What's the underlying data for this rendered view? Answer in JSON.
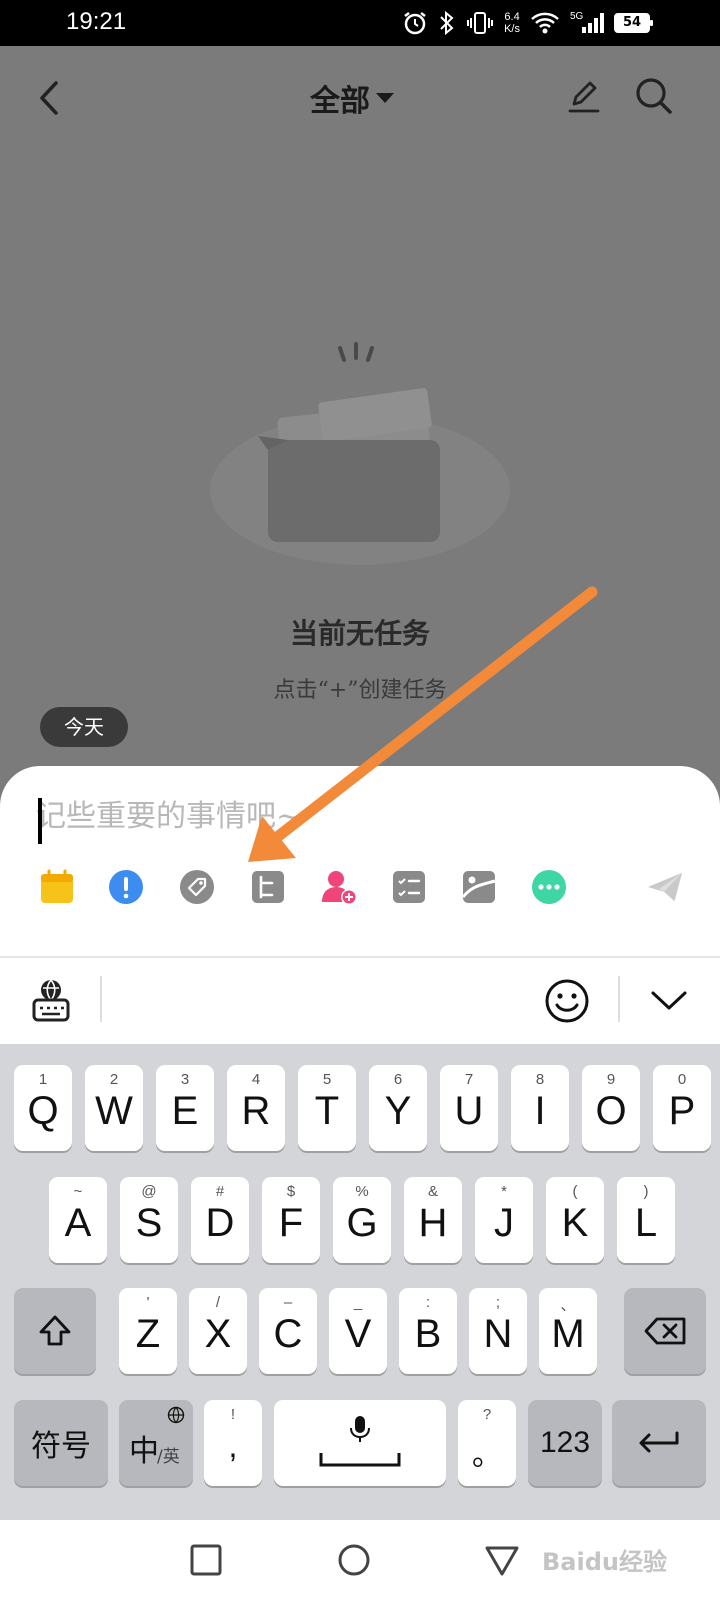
{
  "status_bar": {
    "time": "19:21",
    "net_speed_value": "6.4",
    "net_speed_unit": "K/s",
    "signal_label": "5G",
    "battery": "54"
  },
  "header": {
    "title": "全部",
    "back_icon": "chevron-left-icon",
    "edit_icon": "pencil-icon",
    "search_icon": "search-icon"
  },
  "empty_state": {
    "title": "当前无任务",
    "hint": "点击“+”创建任务"
  },
  "date_pill": "今天",
  "task_input": {
    "placeholder": "记些重要的事情吧~",
    "value": ""
  },
  "tools": [
    {
      "icon": "calendar-icon",
      "color": "#f7c21a"
    },
    {
      "icon": "priority-icon",
      "color": "#3d8df0"
    },
    {
      "icon": "tag-icon",
      "color": "#8a8a8a"
    },
    {
      "icon": "subtask-icon",
      "color": "#8a8a8a"
    },
    {
      "icon": "assign-user-icon",
      "color": "#f0447a"
    },
    {
      "icon": "checklist-icon",
      "color": "#8a8a8a"
    },
    {
      "icon": "image-icon",
      "color": "#8a8a8a"
    },
    {
      "icon": "more-icon",
      "color": "#3fd6a6"
    },
    {
      "icon": "send-icon",
      "color": "#c9c9c9"
    }
  ],
  "keyboard": {
    "row1": [
      {
        "hint": "1",
        "label": "Q"
      },
      {
        "hint": "2",
        "label": "W"
      },
      {
        "hint": "3",
        "label": "E"
      },
      {
        "hint": "4",
        "label": "R"
      },
      {
        "hint": "5",
        "label": "T"
      },
      {
        "hint": "6",
        "label": "Y"
      },
      {
        "hint": "7",
        "label": "U"
      },
      {
        "hint": "8",
        "label": "I"
      },
      {
        "hint": "9",
        "label": "O"
      },
      {
        "hint": "0",
        "label": "P"
      }
    ],
    "row2": [
      {
        "hint": "~",
        "label": "A"
      },
      {
        "hint": "@",
        "label": "S"
      },
      {
        "hint": "#",
        "label": "D"
      },
      {
        "hint": "$",
        "label": "F"
      },
      {
        "hint": "%",
        "label": "G"
      },
      {
        "hint": "&",
        "label": "H"
      },
      {
        "hint": "*",
        "label": "J"
      },
      {
        "hint": "(",
        "label": "K"
      },
      {
        "hint": ")",
        "label": "L"
      }
    ],
    "row3": [
      {
        "hint": "'",
        "label": "Z"
      },
      {
        "hint": "/",
        "label": "X"
      },
      {
        "hint": "–",
        "label": "C"
      },
      {
        "hint": "_",
        "label": "V"
      },
      {
        "hint": ":",
        "label": "B"
      },
      {
        "hint": ";",
        "label": "N"
      },
      {
        "hint": "、",
        "label": "M"
      }
    ],
    "symbols_label": "符号",
    "lang_main": "中",
    "lang_sub": "/英",
    "comma_hint": "!",
    "comma_label": ",",
    "period_hint": "?",
    "period_label": "。",
    "numbers_label": "123"
  },
  "watermark": "Baidu经验",
  "colors": {
    "dim_background": "#7b7b7b",
    "arrow": "#f28a3a",
    "keyboard_bg": "#d4d5d9"
  }
}
